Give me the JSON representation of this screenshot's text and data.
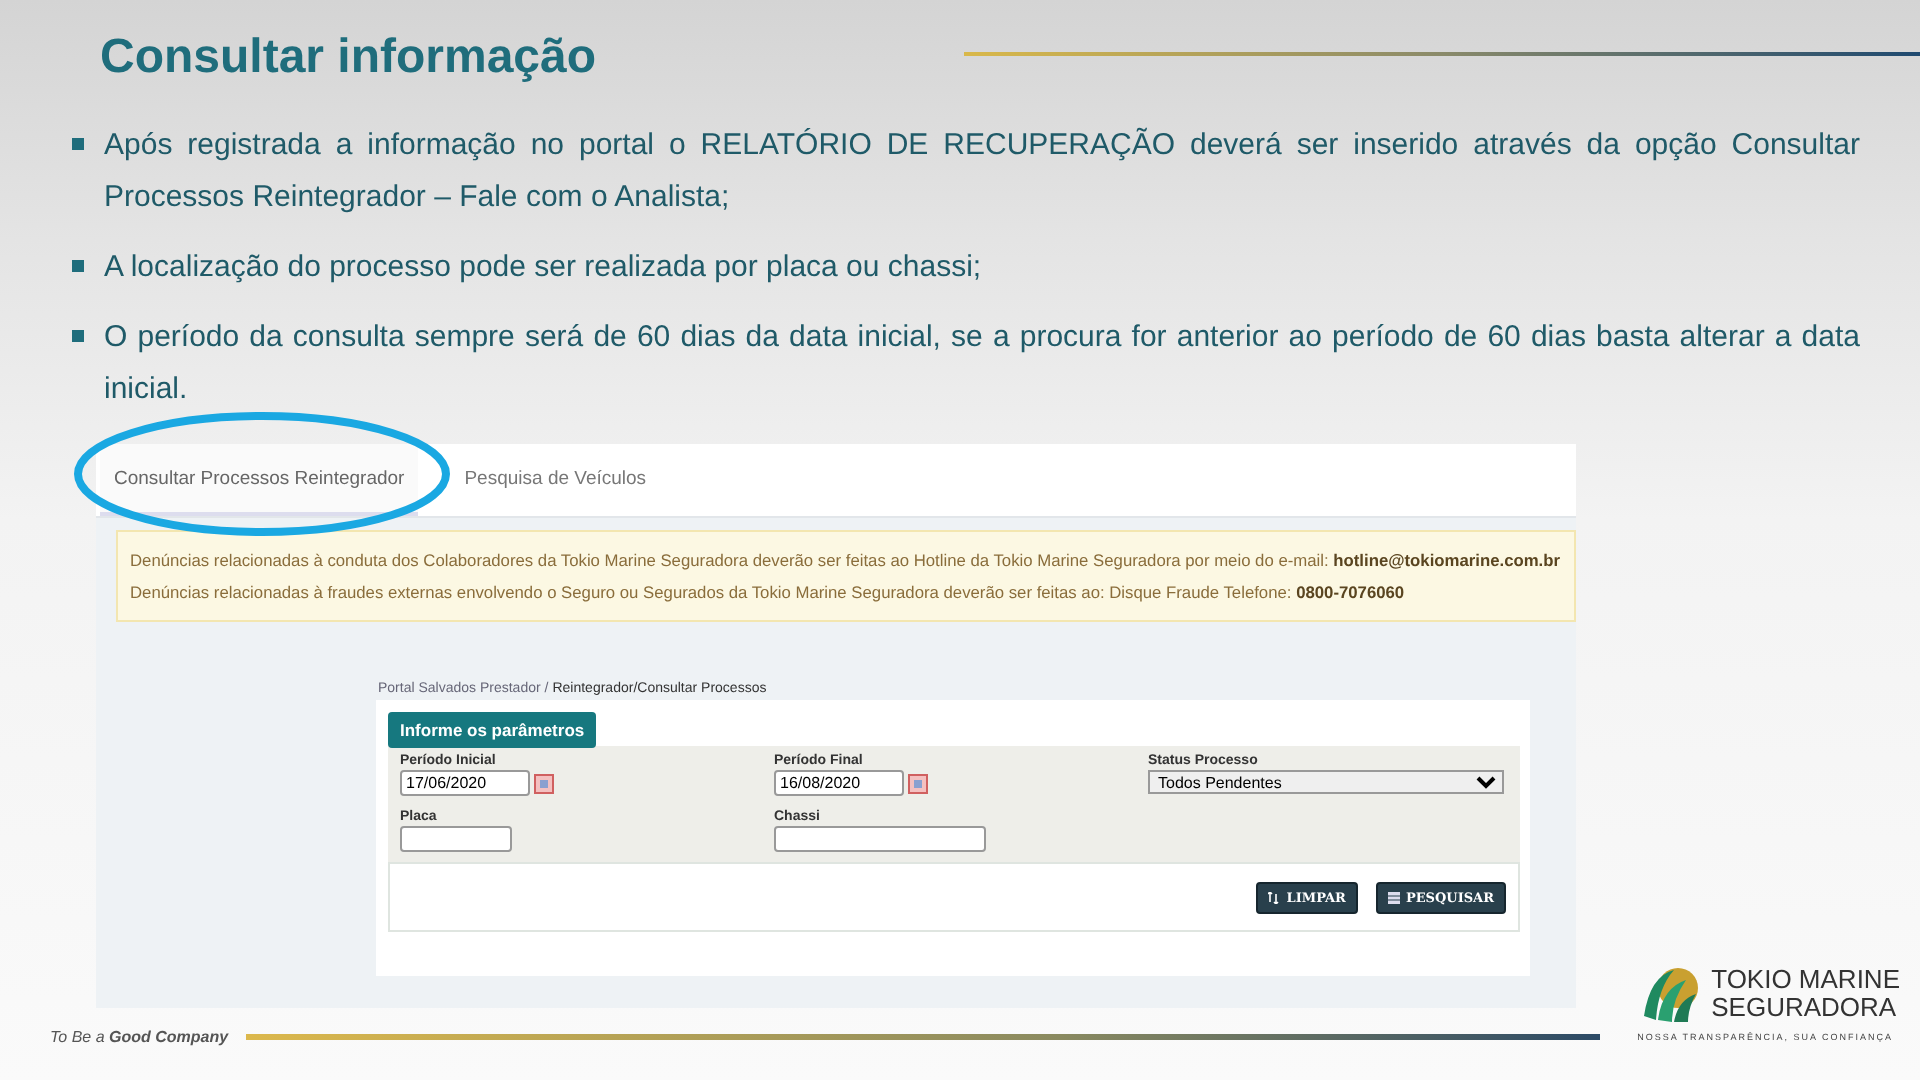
{
  "title": "Consultar informação",
  "bullets": [
    "Após registrada a informação no portal o RELATÓRIO DE RECUPERAÇÃO deverá ser inserido através da opção Consultar Processos Reintegrador – Fale com o Analista;",
    "A localização do processo pode ser realizada por placa ou chassi;",
    "O período da consulta sempre será de 60 dias da data inicial, se a procura for anterior ao período de 60 dias basta alterar a data inicial."
  ],
  "screenshot": {
    "tabs": [
      {
        "label": "Consultar Processos Reintegrador",
        "selected": true
      },
      {
        "label": "Pesquisa de Veículos",
        "selected": false
      }
    ],
    "notices": [
      "Denúncias relacionadas à conduta dos Colaboradores da Tokio Marine Seguradora deverão ser feitas ao Hotline da Tokio Marine Seguradora por meio do e-mail: **hotline@tokiomarine.com.br**",
      "Denúncias relacionadas à fraudes externas envolvendo o Seguro ou Segurados da Tokio Marine Seguradora deverão ser feitas ao: Disque Fraude Telefone: **0800-7076060**"
    ],
    "breadcrumb": {
      "path": "Portal Salvados Prestador /",
      "current": "Reintegrador/Consultar Processos"
    },
    "form": {
      "legend": "Informe os parâmetros",
      "fields": [
        {
          "label": "Período Inicial",
          "kind": "date",
          "value": "17/06/2020"
        },
        {
          "label": "Período Final",
          "kind": "date",
          "value": "16/08/2020"
        },
        {
          "label": "Status Processo",
          "kind": "select",
          "value": "Todos Pendentes"
        },
        {
          "label": "Placa",
          "kind": "text"
        },
        {
          "label": "Chassi",
          "kind": "text"
        }
      ],
      "buttons": [
        {
          "label": "LIMPAR",
          "kind": "clear"
        },
        {
          "label": "PESQUISAR",
          "kind": "search"
        }
      ]
    }
  },
  "footer": {
    "slogan": "To Be a **Good Company**"
  },
  "logo": {
    "line_1": "TOKIO MARINE",
    "line_2": "SEGURADORA",
    "tagline": "NOSSA TRANSPARÊNCIA, SUA CONFIANÇA"
  }
}
